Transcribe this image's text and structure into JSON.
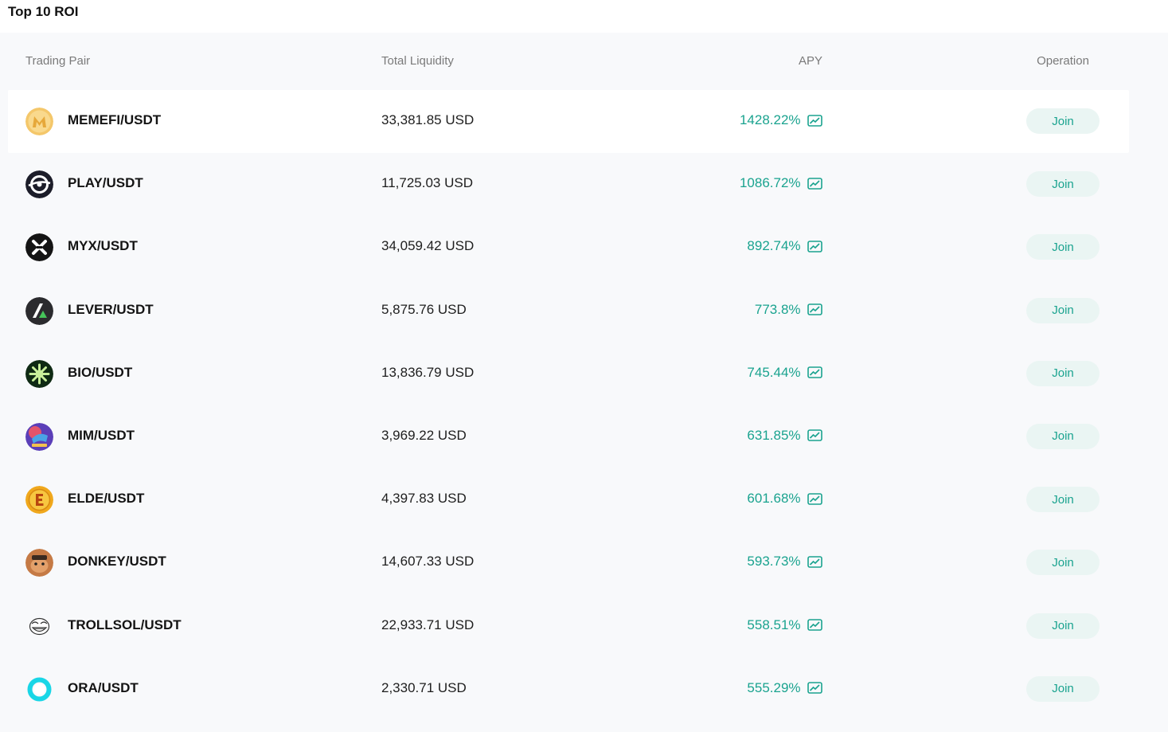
{
  "section": {
    "title": "Top 10 ROI"
  },
  "table": {
    "headers": {
      "pair": "Trading Pair",
      "liquidity": "Total Liquidity",
      "apy": "APY",
      "operation": "Operation"
    },
    "rows": [
      {
        "pair": "MEMEFI/USDT",
        "liquidity": "33,381.85 USD",
        "apy": "1428.22%",
        "action": "Join",
        "icon": "memefi-coin-icon"
      },
      {
        "pair": "PLAY/USDT",
        "liquidity": "11,725.03 USD",
        "apy": "1086.72%",
        "action": "Join",
        "icon": "play-coin-icon"
      },
      {
        "pair": "MYX/USDT",
        "liquidity": "34,059.42 USD",
        "apy": "892.74%",
        "action": "Join",
        "icon": "myx-coin-icon"
      },
      {
        "pair": "LEVER/USDT",
        "liquidity": "5,875.76 USD",
        "apy": "773.8%",
        "action": "Join",
        "icon": "lever-coin-icon"
      },
      {
        "pair": "BIO/USDT",
        "liquidity": "13,836.79 USD",
        "apy": "745.44%",
        "action": "Join",
        "icon": "bio-coin-icon"
      },
      {
        "pair": "MIM/USDT",
        "liquidity": "3,969.22 USD",
        "apy": "631.85%",
        "action": "Join",
        "icon": "mim-coin-icon"
      },
      {
        "pair": "ELDE/USDT",
        "liquidity": "4,397.83 USD",
        "apy": "601.68%",
        "action": "Join",
        "icon": "elde-coin-icon"
      },
      {
        "pair": "DONKEY/USDT",
        "liquidity": "14,607.33 USD",
        "apy": "593.73%",
        "action": "Join",
        "icon": "donkey-coin-icon"
      },
      {
        "pair": "TROLLSOL/USDT",
        "liquidity": "22,933.71 USD",
        "apy": "558.51%",
        "action": "Join",
        "icon": "trollsol-coin-icon"
      },
      {
        "pair": "ORA/USDT",
        "liquidity": "2,330.71 USD",
        "apy": "555.29%",
        "action": "Join",
        "icon": "ora-coin-icon"
      }
    ]
  },
  "colors": {
    "accent": "#1aa38f",
    "button_bg": "#eaf5f3",
    "panel_bg": "#f8f9fb"
  }
}
